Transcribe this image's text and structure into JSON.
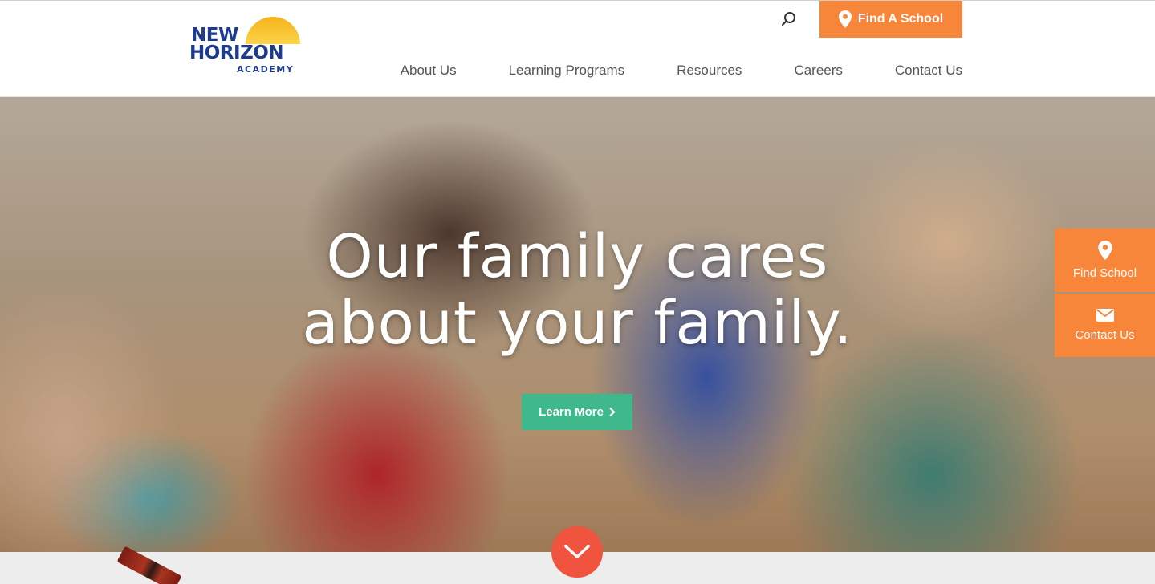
{
  "header": {
    "logo": {
      "line1": "NEW",
      "line2": "HORIZON",
      "line3": "ACADEMY"
    },
    "find_school_label": "Find A School",
    "nav": [
      {
        "label": "About Us"
      },
      {
        "label": "Learning Programs"
      },
      {
        "label": "Resources"
      },
      {
        "label": "Careers"
      },
      {
        "label": "Contact Us"
      }
    ]
  },
  "hero": {
    "title_line1": "Our family cares",
    "title_line2": "about your family.",
    "cta_label": "Learn More"
  },
  "side_buttons": {
    "find_school": "Find School",
    "contact_us": "Contact Us"
  },
  "colors": {
    "brand_blue": "#1d3c8f",
    "accent_orange": "#f7863b",
    "cta_green": "#3fb98b",
    "scroll_red": "#f0533e"
  },
  "icons": [
    "search-icon",
    "map-pin-icon",
    "chevron-right-icon",
    "envelope-icon",
    "chevron-down-icon"
  ]
}
